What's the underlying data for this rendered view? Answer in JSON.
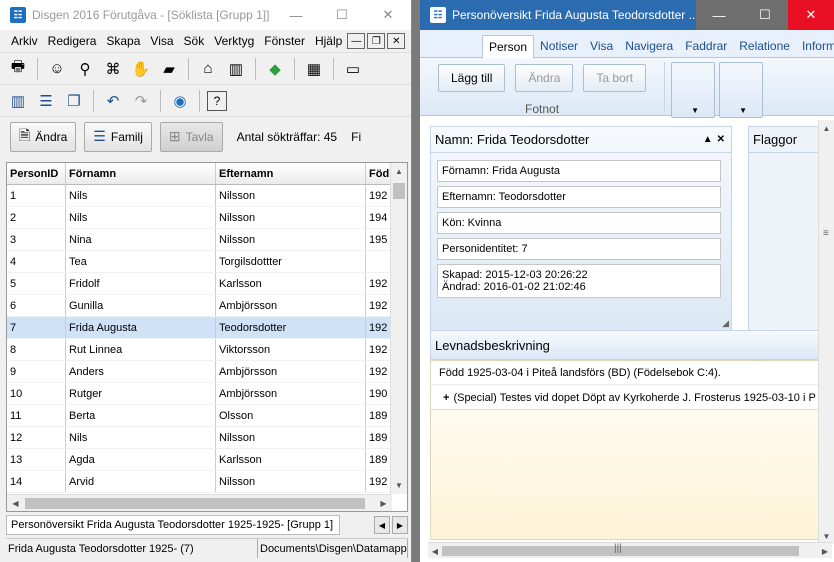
{
  "left_window": {
    "title": "Disgen 2016 Förutgåva - [Söklista [Grupp 1]]",
    "app_icon": "Disgen-logo",
    "menu": [
      "Arkiv",
      "Redigera",
      "Skapa",
      "Visa",
      "Sök",
      "Verktyg",
      "Fönster",
      "Hjälp"
    ],
    "buttons": {
      "edit": "Ändra",
      "family": "Familj",
      "tree": "Tavla"
    },
    "search_count": "Antal sökträffar: 45",
    "search_count_more": "Fi",
    "grid": {
      "columns": [
        "PersonID",
        "Förnamn",
        "Efternamn",
        "Föd"
      ],
      "rows": [
        [
          "1",
          "Nils",
          "Nilsson",
          "192"
        ],
        [
          "2",
          "Nils",
          "Nilsson",
          "194"
        ],
        [
          "3",
          "Nina",
          "Nilsson",
          "195"
        ],
        [
          "4",
          "Tea",
          "Torgilsdottter",
          ""
        ],
        [
          "5",
          "Fridolf",
          "Karlsson",
          "192"
        ],
        [
          "6",
          "Gunilla",
          "Ambjörsson",
          "192"
        ],
        [
          "7",
          "Frida Augusta",
          "Teodorsdotter",
          "192"
        ],
        [
          "8",
          "Rut Linnea",
          "Viktorsson",
          "192"
        ],
        [
          "9",
          "Anders",
          "Ambjörsson",
          "192"
        ],
        [
          "10",
          "Rutger",
          "Ambjörsson",
          "190"
        ],
        [
          "11",
          "Berta",
          "Olsson",
          "189"
        ],
        [
          "12",
          "Nils",
          "Nilsson",
          "189"
        ],
        [
          "13",
          "Agda",
          "Karlsson",
          "189"
        ],
        [
          "14",
          "Arvid",
          "Nilsson",
          "192"
        ]
      ],
      "selected_index": 6
    },
    "window_list": "Personöversikt Frida Augusta Teodorsdotter 1925-1925- [Grupp 1]",
    "status": {
      "person": "Frida Augusta Teodorsdotter 1925- (7)",
      "path": "Documents\\Disgen\\Datamapp"
    }
  },
  "right_window": {
    "title": "Personöversikt Frida Augusta Teodorsdotter ...",
    "tabs": [
      "Person",
      "Notiser",
      "Visa",
      "Navigera",
      "Faddrar",
      "Relatione",
      "Informati"
    ],
    "ribbon": {
      "add": "Lägg till",
      "edit": "Ändra",
      "remove": "Ta bort",
      "group_label": "Fotnot"
    },
    "name_panel": {
      "title": "Namn: Frida Teodorsdotter",
      "fields": [
        "Förnamn: Frida Augusta",
        "Efternamn: Teodorsdotter",
        "Kön: Kvinna",
        "Personidentitet: 7"
      ],
      "created": "Skapad: 2015-12-03 20:26:22",
      "modified": "Ändrad: 2016-01-02 21:02:46"
    },
    "flags_title": "Flaggor",
    "biography": {
      "title": "Levnadsbeskrivning",
      "born": "Född 1925-03-04 i Piteå landsförs (BD) (Födelsebok C:4).",
      "event": "(Special) Testes vid dopet Döpt av Kyrkoherde  J. Frosterus 1925-03-10 i P"
    }
  }
}
